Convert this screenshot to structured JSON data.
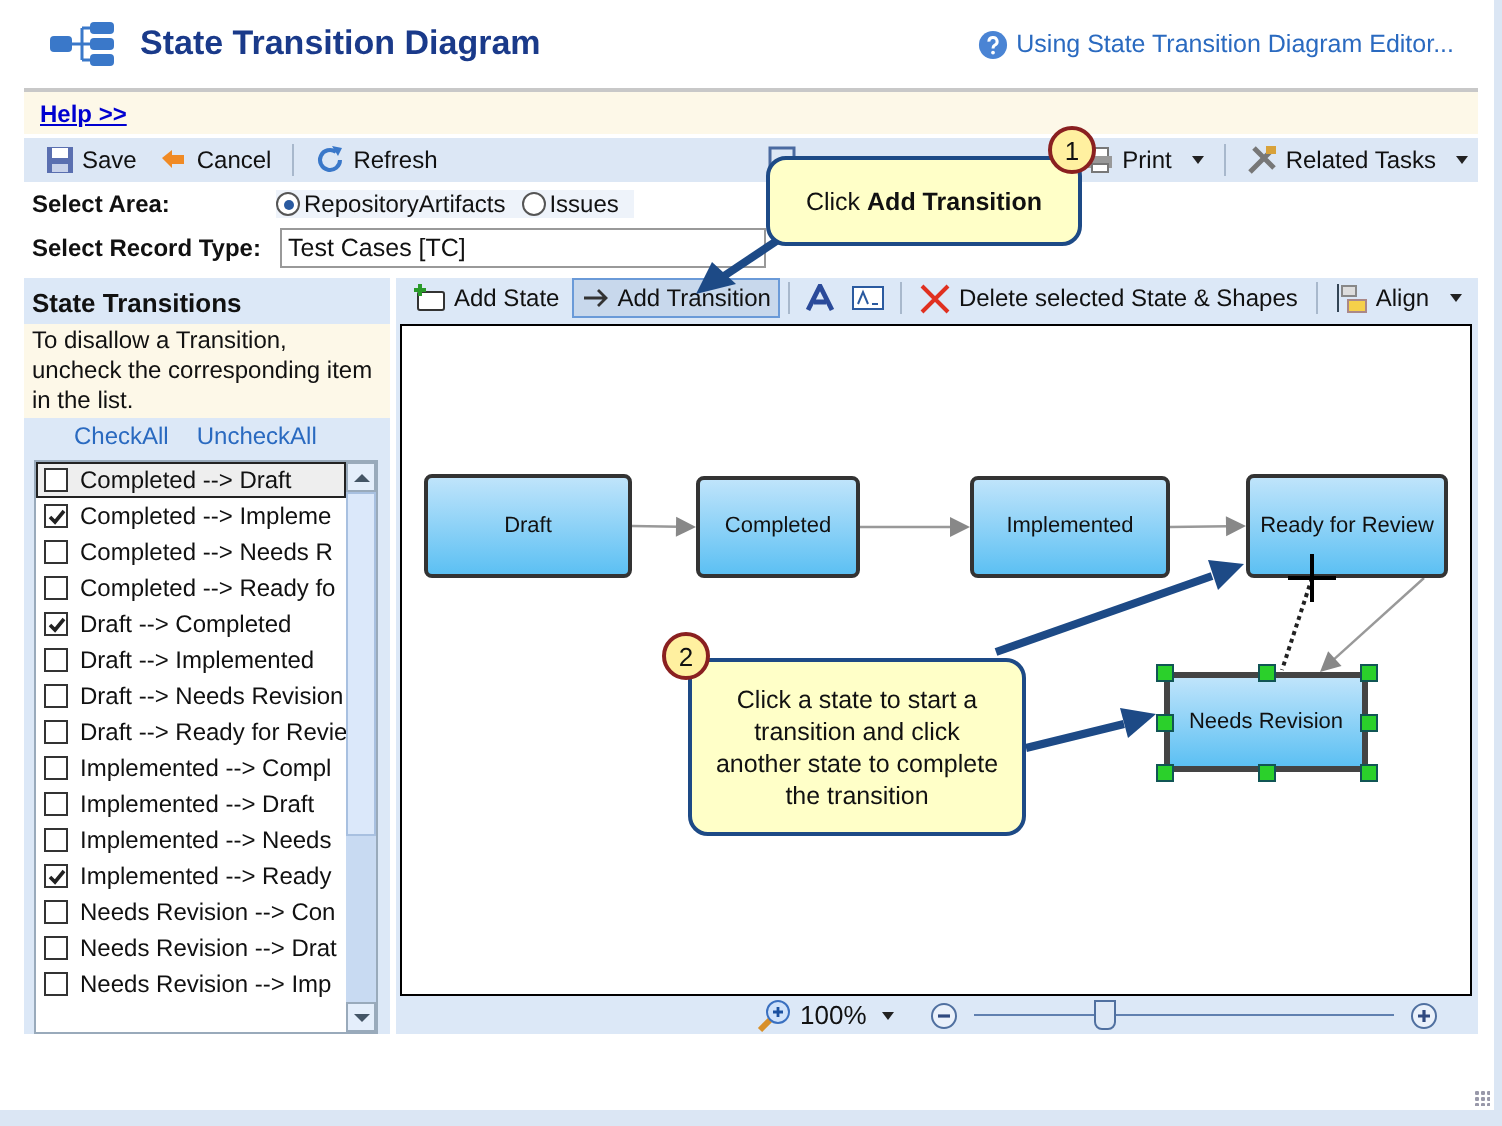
{
  "header": {
    "title": "State Transition Diagram",
    "help_link": "Using State Transition Diagram Editor..."
  },
  "help_link": "Help >>",
  "toolbar": [
    {
      "kind": "save",
      "label": "Save"
    },
    {
      "kind": "cancel",
      "label": "Cancel"
    },
    {
      "kind": "refresh",
      "label": "Refresh"
    },
    {
      "kind": "print",
      "label": "Print"
    },
    {
      "kind": "tasks",
      "label": "Related Tasks"
    }
  ],
  "select_area": {
    "label": "Select Area:",
    "options": [
      {
        "label": "RepositoryArtifacts",
        "selected": true
      },
      {
        "label": "Issues",
        "selected": false
      }
    ]
  },
  "record_type": {
    "label": "Select Record Type:",
    "value": "Test Cases [TC]"
  },
  "transitions_panel": {
    "title": "State Transitions",
    "hint": "To disallow a Transition, uncheck the corresponding item in the list.",
    "check_all": "CheckAll",
    "uncheck_all": "UncheckAll",
    "items": [
      {
        "label": "Completed --> Draft",
        "checked": false,
        "selected": true
      },
      {
        "label": "Completed --> Impleme",
        "checked": true,
        "selected": false
      },
      {
        "label": "Completed --> Needs R",
        "checked": false,
        "selected": false
      },
      {
        "label": "Completed --> Ready fo",
        "checked": false,
        "selected": false
      },
      {
        "label": "Draft --> Completed",
        "checked": true,
        "selected": false
      },
      {
        "label": "Draft --> Implemented",
        "checked": false,
        "selected": false
      },
      {
        "label": "Draft --> Needs Revision",
        "checked": false,
        "selected": false
      },
      {
        "label": "Draft --> Ready for Revie",
        "checked": false,
        "selected": false
      },
      {
        "label": "Implemented --> Compl",
        "checked": false,
        "selected": false
      },
      {
        "label": "Implemented --> Draft",
        "checked": false,
        "selected": false
      },
      {
        "label": "Implemented --> Needs",
        "checked": false,
        "selected": false
      },
      {
        "label": "Implemented --> Ready",
        "checked": true,
        "selected": false
      },
      {
        "label": "Needs Revision --> Con",
        "checked": false,
        "selected": false
      },
      {
        "label": "Needs Revision --> Drat",
        "checked": false,
        "selected": false
      },
      {
        "label": "Needs Revision --> Imp",
        "checked": false,
        "selected": false
      }
    ]
  },
  "diagram_toolbar": [
    {
      "kind": "add-state",
      "label": "Add State",
      "selected": false
    },
    {
      "kind": "add-transition",
      "label": "Add Transition",
      "selected": true
    },
    {
      "kind": "text",
      "selected": false
    },
    {
      "kind": "label",
      "selected": false
    },
    {
      "kind": "delete",
      "label": "Delete selected State & Shapes",
      "selected": false
    },
    {
      "kind": "align",
      "label": "Align",
      "selected": false
    }
  ],
  "states": [
    {
      "label": "Draft",
      "selected": false
    },
    {
      "label": "Completed",
      "selected": false
    },
    {
      "label": "Implemented",
      "selected": false
    },
    {
      "label": "Ready for Review",
      "selected": false
    },
    {
      "label": "Needs Revision",
      "selected": true
    }
  ],
  "zoom": {
    "label": "100%",
    "level": 0.31
  },
  "callouts": [
    {
      "number": "1",
      "text": "Click **Add Transition**"
    },
    {
      "number": "2",
      "text": "Click a state to start a transition and click another state to complete the transition"
    }
  ]
}
